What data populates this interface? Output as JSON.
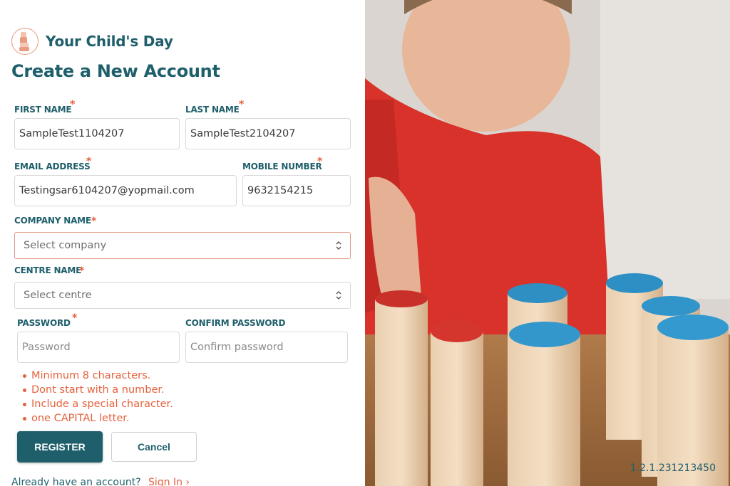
{
  "brand": {
    "name": "Your Child's Day"
  },
  "page": {
    "title": "Create a New Account"
  },
  "form": {
    "first_name": {
      "label": "FIRST NAME",
      "required": "*",
      "value": "SampleTest1104207"
    },
    "last_name": {
      "label": "LAST NAME",
      "required": "*",
      "value": "SampleTest2104207"
    },
    "email": {
      "label": "EMAIL ADDRESS",
      "required": "*",
      "value": "Testingsar6104207@yopmail.com"
    },
    "mobile": {
      "label": "MOBILE NUMBER",
      "required": "*",
      "value": "9632154215"
    },
    "company": {
      "label": "COMPANY NAME",
      "required": "*",
      "selected": "Select company"
    },
    "centre": {
      "label": "CENTRE NAME",
      "required": "*",
      "selected": "Select centre"
    },
    "password": {
      "label": "PASSWORD",
      "required": "*",
      "placeholder": "Password",
      "value": ""
    },
    "confirm_password": {
      "label": "CONFIRM PASSWORD",
      "placeholder": "Confirm password",
      "value": ""
    }
  },
  "password_rules": [
    "Minimum 8 characters.",
    "Dont start with a number.",
    "Include a special character.",
    "one CAPITAL letter."
  ],
  "actions": {
    "register_label": "REGISTER",
    "cancel_label": "Cancel"
  },
  "footer": {
    "already_text": "Already have an account?",
    "signin_label": "Sign In ›"
  },
  "version": "1.2.1.231213450",
  "colors": {
    "primary": "#1f5f6b",
    "accent": "#e5623d",
    "error_border": "#e39a86"
  },
  "icons": {
    "logo": "stacked-blocks-logo-icon",
    "select_arrows": "chevron-up-down-icon"
  }
}
